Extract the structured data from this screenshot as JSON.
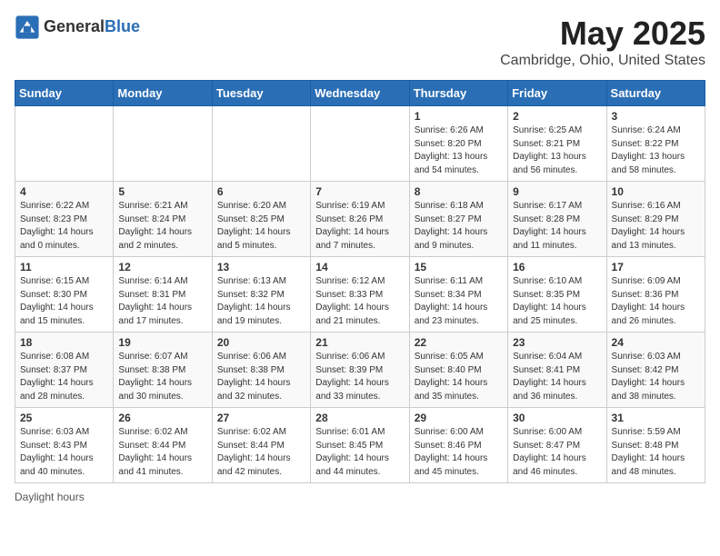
{
  "header": {
    "logo_line1": "General",
    "logo_line2": "Blue",
    "main_title": "May 2025",
    "subtitle": "Cambridge, Ohio, United States"
  },
  "footer": {
    "daylight_label": "Daylight hours"
  },
  "weekdays": [
    "Sunday",
    "Monday",
    "Tuesday",
    "Wednesday",
    "Thursday",
    "Friday",
    "Saturday"
  ],
  "weeks": [
    [
      {
        "day": "",
        "info": ""
      },
      {
        "day": "",
        "info": ""
      },
      {
        "day": "",
        "info": ""
      },
      {
        "day": "",
        "info": ""
      },
      {
        "day": "1",
        "info": "Sunrise: 6:26 AM\nSunset: 8:20 PM\nDaylight: 13 hours\nand 54 minutes."
      },
      {
        "day": "2",
        "info": "Sunrise: 6:25 AM\nSunset: 8:21 PM\nDaylight: 13 hours\nand 56 minutes."
      },
      {
        "day": "3",
        "info": "Sunrise: 6:24 AM\nSunset: 8:22 PM\nDaylight: 13 hours\nand 58 minutes."
      }
    ],
    [
      {
        "day": "4",
        "info": "Sunrise: 6:22 AM\nSunset: 8:23 PM\nDaylight: 14 hours\nand 0 minutes."
      },
      {
        "day": "5",
        "info": "Sunrise: 6:21 AM\nSunset: 8:24 PM\nDaylight: 14 hours\nand 2 minutes."
      },
      {
        "day": "6",
        "info": "Sunrise: 6:20 AM\nSunset: 8:25 PM\nDaylight: 14 hours\nand 5 minutes."
      },
      {
        "day": "7",
        "info": "Sunrise: 6:19 AM\nSunset: 8:26 PM\nDaylight: 14 hours\nand 7 minutes."
      },
      {
        "day": "8",
        "info": "Sunrise: 6:18 AM\nSunset: 8:27 PM\nDaylight: 14 hours\nand 9 minutes."
      },
      {
        "day": "9",
        "info": "Sunrise: 6:17 AM\nSunset: 8:28 PM\nDaylight: 14 hours\nand 11 minutes."
      },
      {
        "day": "10",
        "info": "Sunrise: 6:16 AM\nSunset: 8:29 PM\nDaylight: 14 hours\nand 13 minutes."
      }
    ],
    [
      {
        "day": "11",
        "info": "Sunrise: 6:15 AM\nSunset: 8:30 PM\nDaylight: 14 hours\nand 15 minutes."
      },
      {
        "day": "12",
        "info": "Sunrise: 6:14 AM\nSunset: 8:31 PM\nDaylight: 14 hours\nand 17 minutes."
      },
      {
        "day": "13",
        "info": "Sunrise: 6:13 AM\nSunset: 8:32 PM\nDaylight: 14 hours\nand 19 minutes."
      },
      {
        "day": "14",
        "info": "Sunrise: 6:12 AM\nSunset: 8:33 PM\nDaylight: 14 hours\nand 21 minutes."
      },
      {
        "day": "15",
        "info": "Sunrise: 6:11 AM\nSunset: 8:34 PM\nDaylight: 14 hours\nand 23 minutes."
      },
      {
        "day": "16",
        "info": "Sunrise: 6:10 AM\nSunset: 8:35 PM\nDaylight: 14 hours\nand 25 minutes."
      },
      {
        "day": "17",
        "info": "Sunrise: 6:09 AM\nSunset: 8:36 PM\nDaylight: 14 hours\nand 26 minutes."
      }
    ],
    [
      {
        "day": "18",
        "info": "Sunrise: 6:08 AM\nSunset: 8:37 PM\nDaylight: 14 hours\nand 28 minutes."
      },
      {
        "day": "19",
        "info": "Sunrise: 6:07 AM\nSunset: 8:38 PM\nDaylight: 14 hours\nand 30 minutes."
      },
      {
        "day": "20",
        "info": "Sunrise: 6:06 AM\nSunset: 8:38 PM\nDaylight: 14 hours\nand 32 minutes."
      },
      {
        "day": "21",
        "info": "Sunrise: 6:06 AM\nSunset: 8:39 PM\nDaylight: 14 hours\nand 33 minutes."
      },
      {
        "day": "22",
        "info": "Sunrise: 6:05 AM\nSunset: 8:40 PM\nDaylight: 14 hours\nand 35 minutes."
      },
      {
        "day": "23",
        "info": "Sunrise: 6:04 AM\nSunset: 8:41 PM\nDaylight: 14 hours\nand 36 minutes."
      },
      {
        "day": "24",
        "info": "Sunrise: 6:03 AM\nSunset: 8:42 PM\nDaylight: 14 hours\nand 38 minutes."
      }
    ],
    [
      {
        "day": "25",
        "info": "Sunrise: 6:03 AM\nSunset: 8:43 PM\nDaylight: 14 hours\nand 40 minutes."
      },
      {
        "day": "26",
        "info": "Sunrise: 6:02 AM\nSunset: 8:44 PM\nDaylight: 14 hours\nand 41 minutes."
      },
      {
        "day": "27",
        "info": "Sunrise: 6:02 AM\nSunset: 8:44 PM\nDaylight: 14 hours\nand 42 minutes."
      },
      {
        "day": "28",
        "info": "Sunrise: 6:01 AM\nSunset: 8:45 PM\nDaylight: 14 hours\nand 44 minutes."
      },
      {
        "day": "29",
        "info": "Sunrise: 6:00 AM\nSunset: 8:46 PM\nDaylight: 14 hours\nand 45 minutes."
      },
      {
        "day": "30",
        "info": "Sunrise: 6:00 AM\nSunset: 8:47 PM\nDaylight: 14 hours\nand 46 minutes."
      },
      {
        "day": "31",
        "info": "Sunrise: 5:59 AM\nSunset: 8:48 PM\nDaylight: 14 hours\nand 48 minutes."
      }
    ]
  ]
}
